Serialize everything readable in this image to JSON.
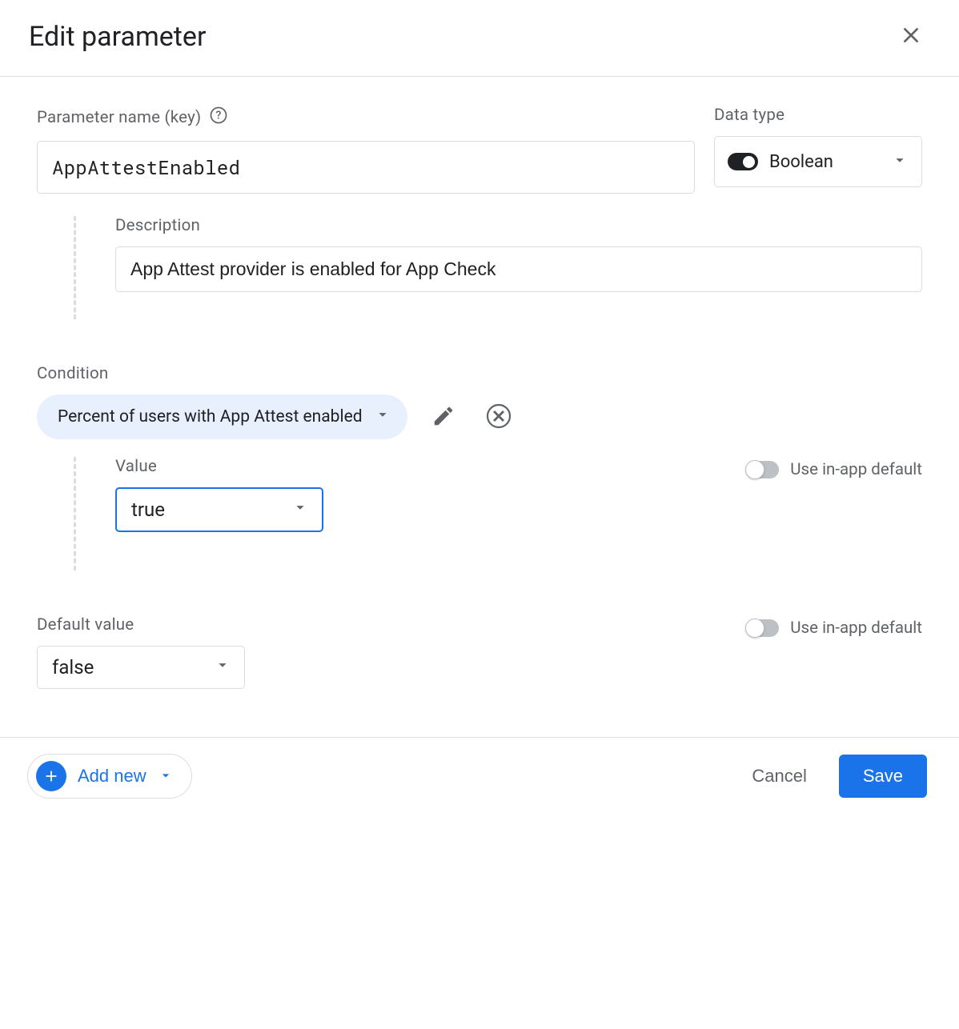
{
  "header": {
    "title": "Edit parameter"
  },
  "param": {
    "name_label": "Parameter name (key)",
    "name_value": "AppAttestEnabled",
    "data_type_label": "Data type",
    "data_type_value": "Boolean",
    "description_label": "Description",
    "description_value": "App Attest provider is enabled for App Check"
  },
  "condition": {
    "label": "Condition",
    "chip_text": "Percent of users with App Attest enabled",
    "value_label": "Value",
    "value_selected": "true",
    "use_inapp_label": "Use in-app default"
  },
  "default": {
    "label": "Default value",
    "value_selected": "false",
    "use_inapp_label": "Use in-app default"
  },
  "footer": {
    "add_new": "Add new",
    "cancel": "Cancel",
    "save": "Save"
  }
}
